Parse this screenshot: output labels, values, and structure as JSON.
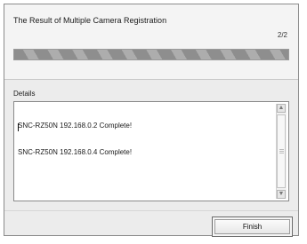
{
  "dialog": {
    "title": "The Result of Multiple Camera Registration",
    "step": "2/2",
    "progress_fraction": 1.0
  },
  "details": {
    "label": "Details",
    "lines": [
      "SNC-RZ50N 192.168.0.2 Complete!",
      "SNC-RZ50N 192.168.0.4 Complete!"
    ]
  },
  "buttons": {
    "finish_label": "Finish"
  },
  "icons": {
    "scroll_up": "triangle-up-icon",
    "scroll_down": "triangle-down-icon"
  }
}
